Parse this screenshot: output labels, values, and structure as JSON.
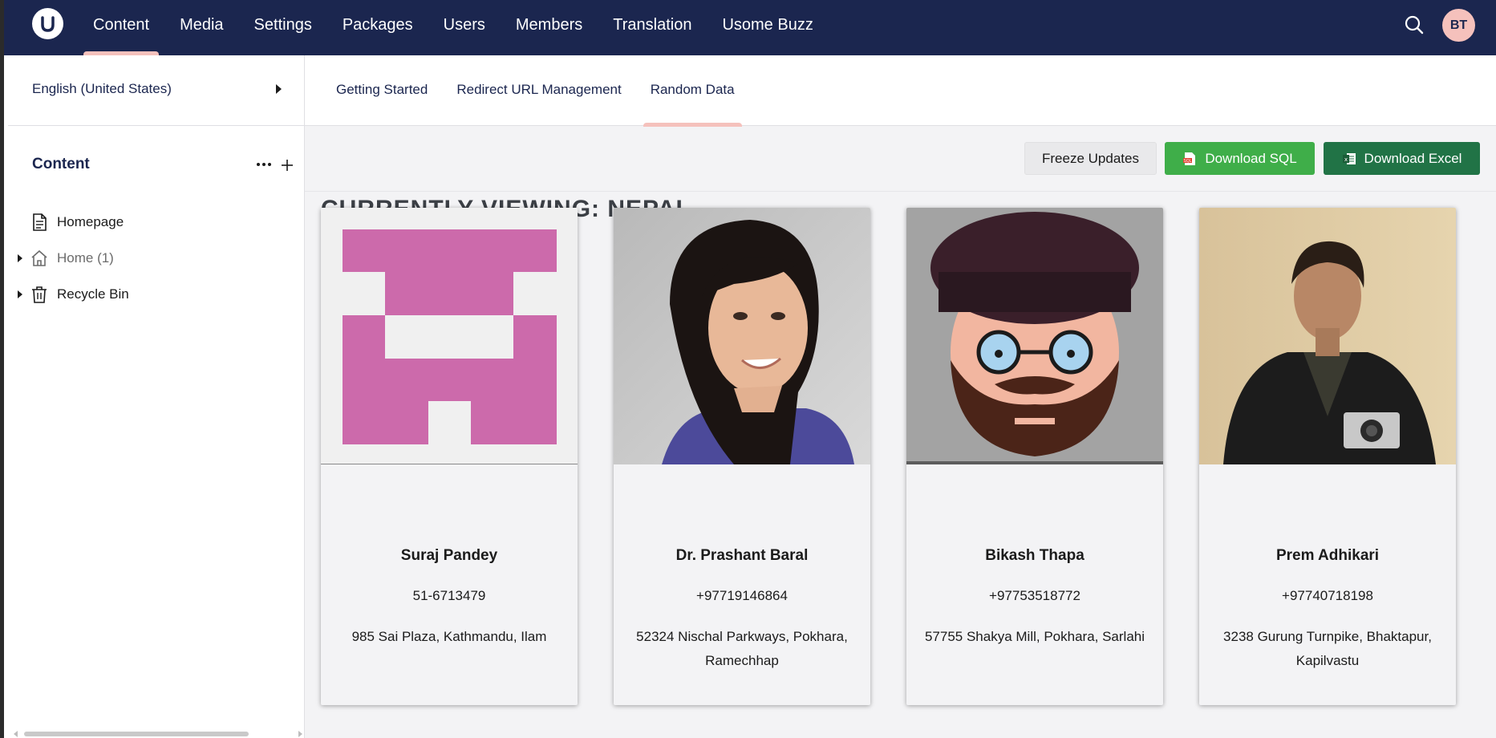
{
  "nav": {
    "items": [
      {
        "label": "Content",
        "active": true
      },
      {
        "label": "Media"
      },
      {
        "label": "Settings"
      },
      {
        "label": "Packages"
      },
      {
        "label": "Users"
      },
      {
        "label": "Members"
      },
      {
        "label": "Translation"
      },
      {
        "label": "Usome Buzz"
      }
    ],
    "avatar_initials": "BT"
  },
  "sidebar": {
    "language": "English (United States)",
    "section_title": "Content",
    "tree": [
      {
        "label": "Homepage",
        "icon": "document-icon"
      },
      {
        "label": "Home (1)",
        "icon": "home-icon"
      },
      {
        "label": "Recycle Bin",
        "icon": "trash-icon"
      }
    ]
  },
  "tabs": [
    {
      "label": "Getting Started"
    },
    {
      "label": "Redirect URL Management"
    },
    {
      "label": "Random Data",
      "active": true
    }
  ],
  "main": {
    "title": "CURRENTLY VIEWING: NEPAL",
    "buttons": {
      "freeze": "Freeze Updates",
      "sql": "Download SQL",
      "excel": "Download Excel"
    }
  },
  "people": [
    {
      "name": "Suraj Pandey",
      "phone": "51-6713479",
      "address": "985 Sai Plaza, Kathmandu, Ilam",
      "avatar": "identicon"
    },
    {
      "name": "Dr. Prashant Baral",
      "phone": "+97719146864",
      "address": "52324 Nischal Parkways, Pokhara, Ramechhap",
      "avatar": "photo-woman"
    },
    {
      "name": "Bikash Thapa",
      "phone": "+97753518772",
      "address": "57755 Shakya Mill, Pokhara, Sarlahi",
      "avatar": "cartoon-man"
    },
    {
      "name": "Prem Adhikari",
      "phone": "+97740718198",
      "address": "3238 Gurung Turnpike, Bhaktapur, Kapilvastu",
      "avatar": "photo-man"
    }
  ],
  "colors": {
    "topbar": "#1b264f",
    "accent": "#f5c1bc",
    "sql_green": "#3fae49",
    "excel_green": "#217346",
    "identicon": "#cc6aab"
  }
}
